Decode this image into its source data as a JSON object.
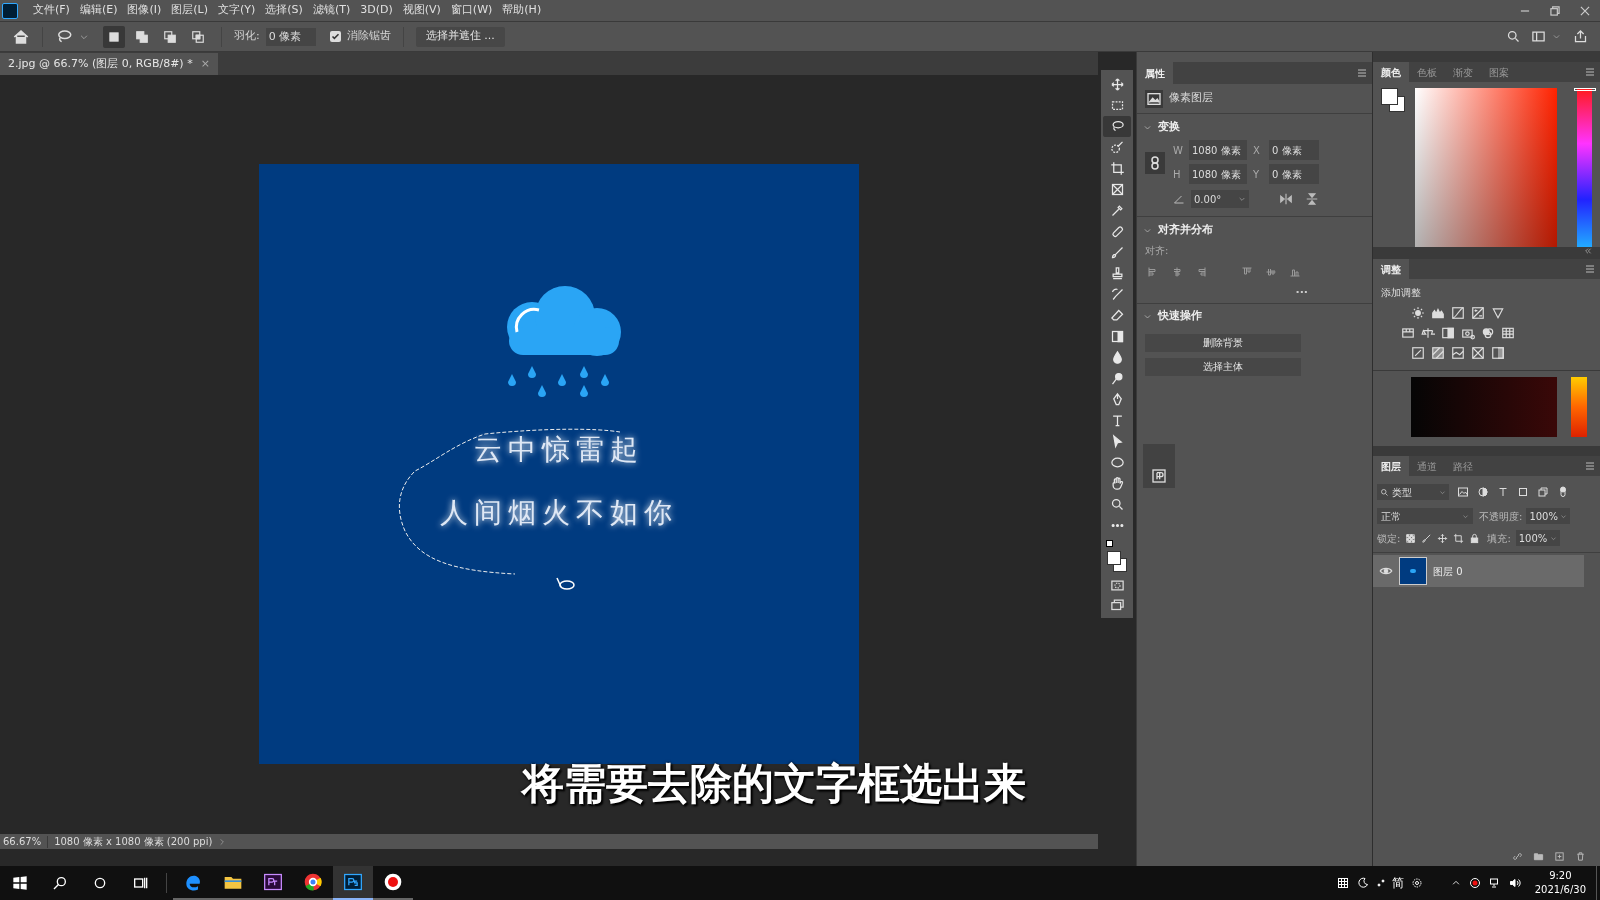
{
  "menu": [
    "文件(F)",
    "编辑(E)",
    "图像(I)",
    "图层(L)",
    "文字(Y)",
    "选择(S)",
    "滤镜(T)",
    "3D(D)",
    "视图(V)",
    "窗口(W)",
    "帮助(H)"
  ],
  "options": {
    "modes": [
      {
        "selected": true
      },
      {
        "selected": false
      },
      {
        "selected": false
      },
      {
        "selected": false
      }
    ],
    "feather_label": "羽化:",
    "feather_value": "0 像素",
    "antialias": {
      "label": "消除锯齿",
      "checked": true
    },
    "select_mask": "选择并遮住 ..."
  },
  "document_tab": {
    "title": "2.jpg @ 66.7% (图层 0, RGB/8#) *",
    "close": "×"
  },
  "canvas": {
    "lines": [
      "云中惊雷起",
      "人间烟火不如你"
    ]
  },
  "caption": "将需要去除的文字框选出来",
  "status_bar": {
    "zoom": "66.67%",
    "info": "1080 像素 x 1080 像素 (200 ppi)"
  },
  "tools": [
    {
      "kind": "move",
      "selected": false
    },
    {
      "kind": "marquee",
      "selected": false
    },
    {
      "kind": "lasso",
      "selected": true
    },
    {
      "kind": "quick-select",
      "selected": false
    },
    {
      "kind": "crop",
      "selected": false
    },
    {
      "kind": "frame",
      "selected": false
    },
    {
      "kind": "eyedropper",
      "selected": false
    },
    {
      "kind": "healing",
      "selected": false
    },
    {
      "kind": "brush",
      "selected": false
    },
    {
      "kind": "stamp",
      "selected": false
    },
    {
      "kind": "history-brush",
      "selected": false
    },
    {
      "kind": "eraser",
      "selected": false
    },
    {
      "kind": "gradient",
      "selected": false
    },
    {
      "kind": "blur",
      "selected": false
    },
    {
      "kind": "dodge",
      "selected": false
    },
    {
      "kind": "pen",
      "selected": false
    },
    {
      "kind": "type",
      "selected": false
    },
    {
      "kind": "path-select",
      "selected": false
    },
    {
      "kind": "ellipse",
      "selected": false
    },
    {
      "kind": "hand",
      "selected": false
    },
    {
      "kind": "zoom",
      "selected": false
    },
    {
      "kind": "more",
      "selected": false
    }
  ],
  "properties": {
    "tab": "属性",
    "layer_type": "像素图层",
    "transform": {
      "title": "变换",
      "w_label": "W",
      "w": "1080 像素",
      "x_label": "X",
      "x": "0 像素",
      "h_label": "H",
      "h": "1080 像素",
      "y_label": "Y",
      "y": "0 像素",
      "angle": "0.00°"
    },
    "align": {
      "title": "对齐并分布",
      "label": "对齐:",
      "more": "..."
    },
    "quick": {
      "title": "快速操作",
      "buttons": [
        "删除背景",
        "选择主体"
      ]
    }
  },
  "color_panel": {
    "hue_slider": {
      "level": 0
    },
    "tabs": [
      {
        "label": "颜色",
        "selected": true
      },
      {
        "label": "色板",
        "selected": false
      },
      {
        "label": "渐变",
        "selected": false
      },
      {
        "label": "图案",
        "selected": false
      }
    ]
  },
  "adjustments": {
    "tab": "调整",
    "heading": "添加调整"
  },
  "layers_panel": {
    "tabs": [
      {
        "label": "图层",
        "selected": true
      },
      {
        "label": "通道",
        "selected": false
      },
      {
        "label": "路径",
        "selected": false
      }
    ],
    "filter": "类型",
    "blend": "正常",
    "opacity_label": "不透明度:",
    "opacity": "100%",
    "lock_label": "锁定:",
    "fill_label": "填充:",
    "fill": "100%",
    "layers": [
      {
        "name": "图层 0",
        "visible": true,
        "selected": true
      }
    ]
  },
  "taskbar": {
    "ime": "简",
    "time": "9:20",
    "date": "2021/6/30"
  }
}
